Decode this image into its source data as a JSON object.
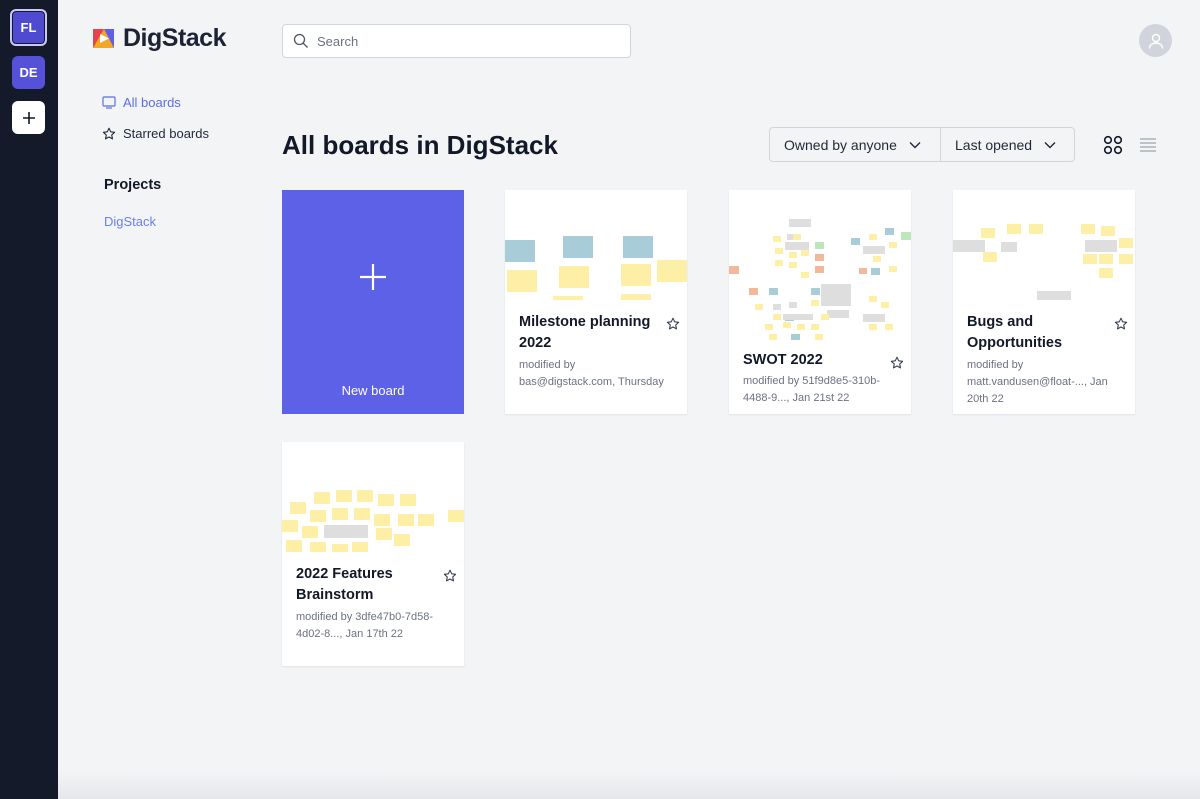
{
  "workspaces": [
    {
      "initials": "FL"
    },
    {
      "initials": "DE"
    }
  ],
  "add_workspace_label": "+",
  "logo": {
    "text": "DigStack"
  },
  "nav": {
    "all_boards": "All boards",
    "starred_boards": "Starred boards",
    "projects_title": "Projects",
    "projects": [
      "DigStack"
    ]
  },
  "search": {
    "placeholder": "Search",
    "value": ""
  },
  "page_title": "All boards in DigStack",
  "filters": {
    "owner": "Owned by anyone",
    "sort": "Last opened"
  },
  "new_board": {
    "label": "New board"
  },
  "boards": [
    {
      "title": "Milestone planning 2022",
      "meta": "modified by bas@digstack.com, Thursday"
    },
    {
      "title": "SWOT 2022",
      "meta": "modified by 51f9d8e5-310b-4488-9..., Jan 21st 22"
    },
    {
      "title": "Bugs and Opportunities",
      "meta": "modified by matt.vandusen@float-..., Jan 20th 22"
    },
    {
      "title": "2022 Features Brainstorm",
      "meta": "modified by 3dfe47b0-7d58-4d02-8..., Jan 17th 22"
    }
  ],
  "colors": {
    "accent": "#5d61e8",
    "link": "#5b6ee8",
    "rail": "#141a2a"
  }
}
